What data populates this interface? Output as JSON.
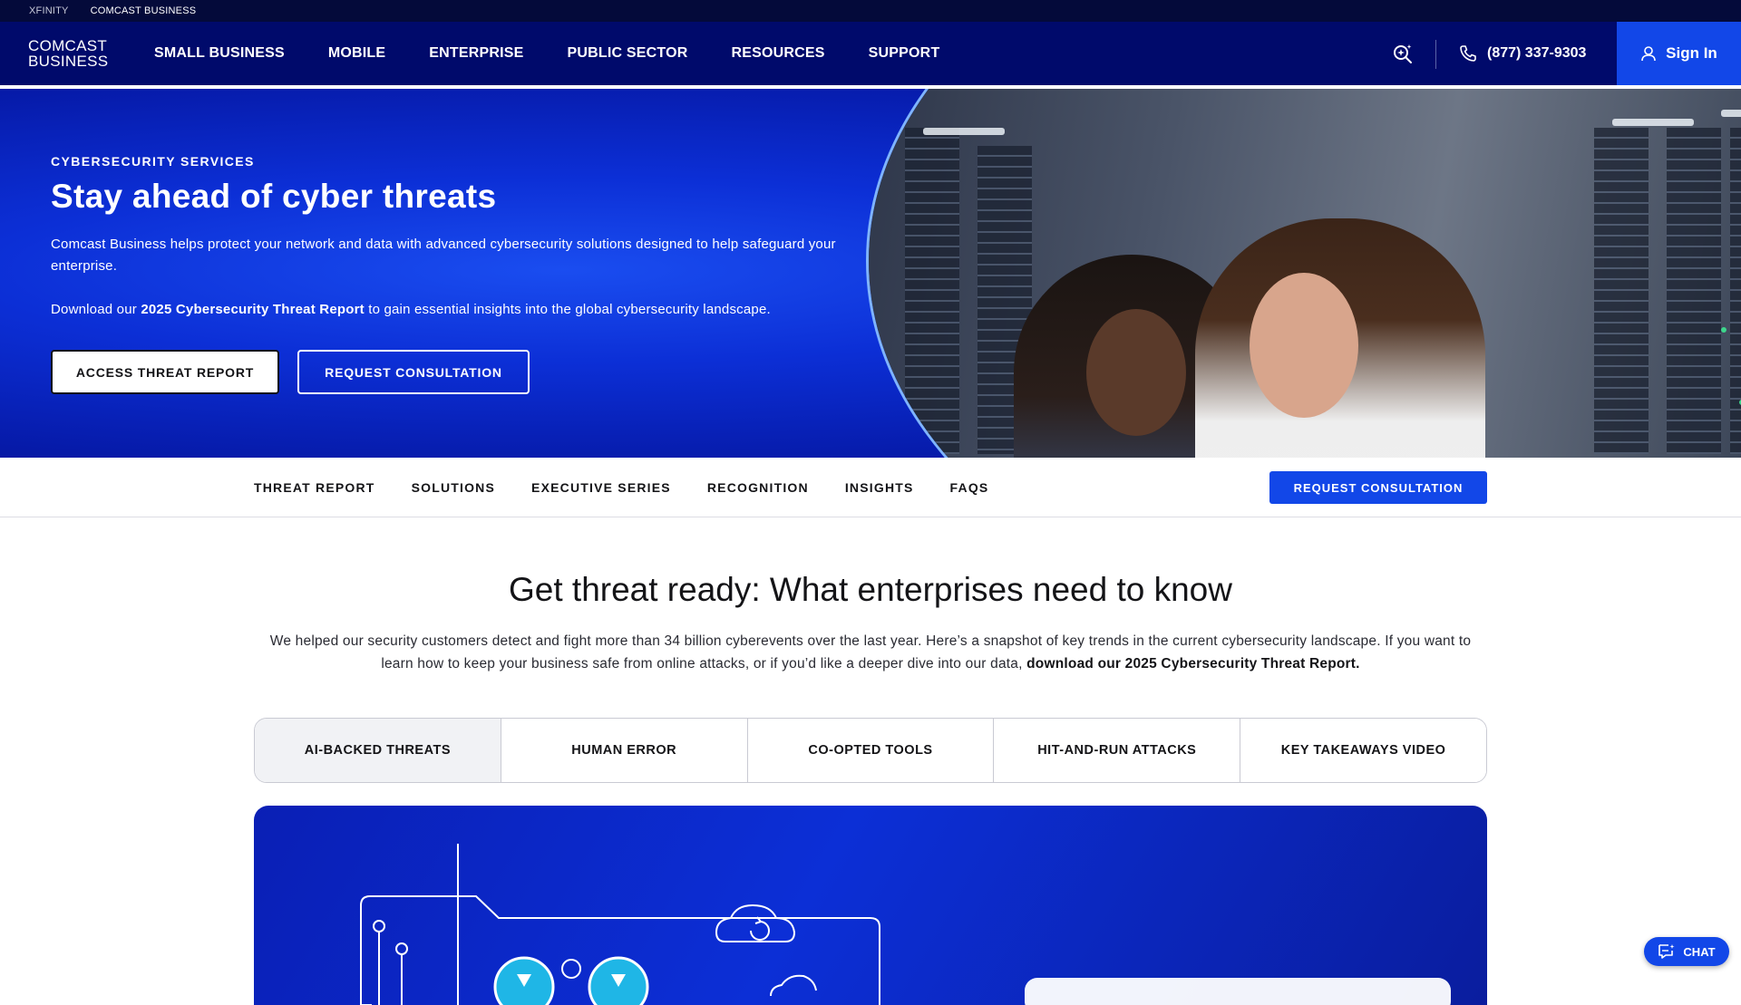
{
  "topbar": {
    "links": [
      "XFINITY",
      "COMCAST BUSINESS"
    ]
  },
  "brand": {
    "line1": "COMCAST",
    "line2": "BUSINESS"
  },
  "nav": {
    "items": [
      "SMALL BUSINESS",
      "MOBILE",
      "ENTERPRISE",
      "PUBLIC SECTOR",
      "RESOURCES",
      "SUPPORT"
    ],
    "phone": "(877) 337-9303",
    "signin": "Sign In"
  },
  "hero": {
    "eyebrow": "CYBERSECURITY SERVICES",
    "title": "Stay ahead of cyber threats",
    "body": "Comcast Business helps protect your network and data with advanced cybersecurity solutions designed to help safeguard your enterprise.",
    "body2_prefix": "Download our ",
    "body2_bold": "2025 Cybersecurity Threat Report",
    "body2_suffix": " to gain essential insights into the global cybersecurity landscape.",
    "btn_primary": "ACCESS THREAT REPORT",
    "btn_secondary": "REQUEST CONSULTATION"
  },
  "subnav": {
    "items": [
      "THREAT REPORT",
      "SOLUTIONS",
      "EXECUTIVE SERIES",
      "RECOGNITION",
      "INSIGHTS",
      "FAQS"
    ],
    "cta": "REQUEST CONSULTATION"
  },
  "section": {
    "title": "Get threat ready: What enterprises need to know",
    "body": "We helped our security customers detect and fight more than 34 billion cyberevents over the last year. Here’s a snapshot of key trends in the current cybersecurity landscape. If you want to learn how to keep your business safe from online attacks, or if you’d like a deeper dive into our data, ",
    "body_bold": "download our 2025 Cybersecurity Threat Report."
  },
  "tabs": [
    "AI-BACKED THREATS",
    "HUMAN ERROR",
    "CO-OPTED TOOLS",
    "HIT-AND-RUN ATTACKS",
    "KEY TAKEAWAYS VIDEO"
  ],
  "chat": {
    "label": "CHAT"
  },
  "colors": {
    "navy": "#000a6b",
    "brand_blue": "#1247e8",
    "hero_blue": "#0c2fd6"
  }
}
